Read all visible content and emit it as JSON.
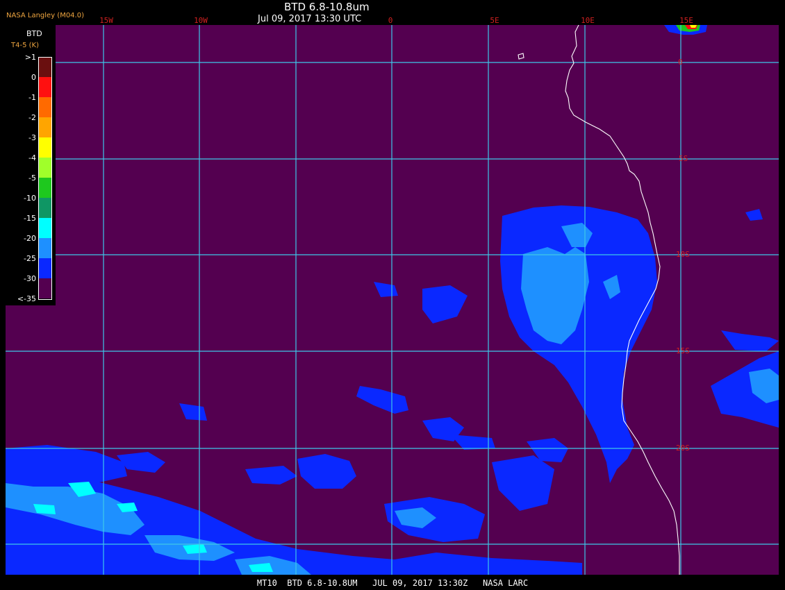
{
  "header": {
    "brand": "NASA Langley (M04.0)",
    "title": "BTD 6.8-10.8um",
    "datetime": "Jul 09, 2017 13:30 UTC"
  },
  "longitude_labels": [
    "15W",
    "10W",
    "0",
    "5E",
    "10E",
    "15E"
  ],
  "latitude_labels": [
    "0",
    "5S",
    "10S",
    "15S",
    "20S"
  ],
  "legend": {
    "title": "BTD",
    "subtitle": "T4-5 (K)",
    "entries": [
      {
        "label": ">1",
        "color": "#6a0f0f"
      },
      {
        "label": "0",
        "color": "#ff1010"
      },
      {
        "label": "-1",
        "color": "#ff6a00"
      },
      {
        "label": "-2",
        "color": "#ffa500"
      },
      {
        "label": "-3",
        "color": "#ffff00"
      },
      {
        "label": "-4",
        "color": "#a0ff2a"
      },
      {
        "label": "-5",
        "color": "#1ec81e"
      },
      {
        "label": "-10",
        "color": "#0f9664"
      },
      {
        "label": "-15",
        "color": "#00ffff"
      },
      {
        "label": "-20",
        "color": "#1e90ff"
      },
      {
        "label": "-25",
        "color": "#0a28ff"
      },
      {
        "label": "-30",
        "color": "#540050"
      },
      {
        "label": "<-35",
        "color": ""
      }
    ]
  },
  "footer": "MT10  BTD 6.8-10.8UM   JUL 09, 2017 13:30Z   NASA LARC",
  "colors": {
    "background": "#540050",
    "grid": "#3ec8e8",
    "label": "#d02020",
    "coast": "#ffffff"
  }
}
